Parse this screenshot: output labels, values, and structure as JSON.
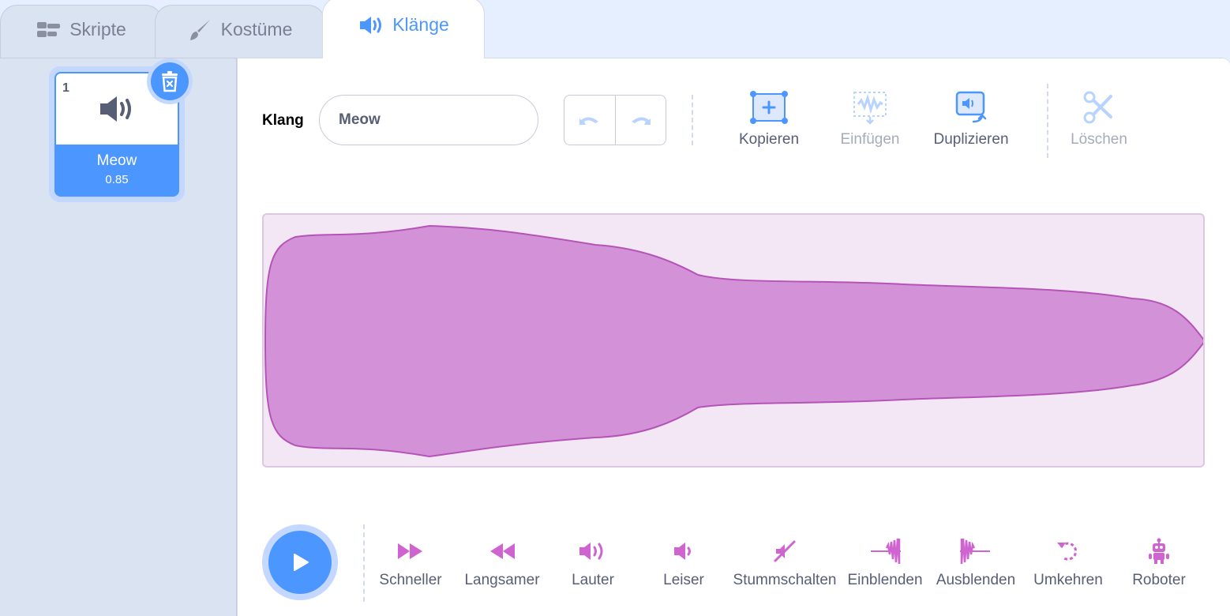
{
  "tabs": [
    {
      "label": "Skripte",
      "icon": "code-icon"
    },
    {
      "label": "Kostüme",
      "icon": "brush-icon"
    },
    {
      "label": "Klänge",
      "icon": "speaker-icon",
      "active": true
    }
  ],
  "sounds": [
    {
      "index": "1",
      "name": "Meow",
      "length": "0.85",
      "selected": true
    }
  ],
  "editor": {
    "name_label": "Klang",
    "name_value": "Meow",
    "tools": {
      "copy": "Kopieren",
      "paste": "Einfügen",
      "duplicate": "Duplizieren",
      "delete": "Löschen"
    }
  },
  "effects": {
    "faster": "Schneller",
    "slower": "Langsamer",
    "louder": "Lauter",
    "softer": "Leiser",
    "mute": "Stummschalten",
    "fade_in": "Einblenden",
    "fade_out": "Ausblenden",
    "reverse": "Umkehren",
    "robot": "Roboter"
  },
  "colors": {
    "accent": "#4c97ff",
    "sound_purple": "#cf63cf",
    "wave_fill": "#d392d8",
    "wave_bg": "#f3e6f5"
  }
}
